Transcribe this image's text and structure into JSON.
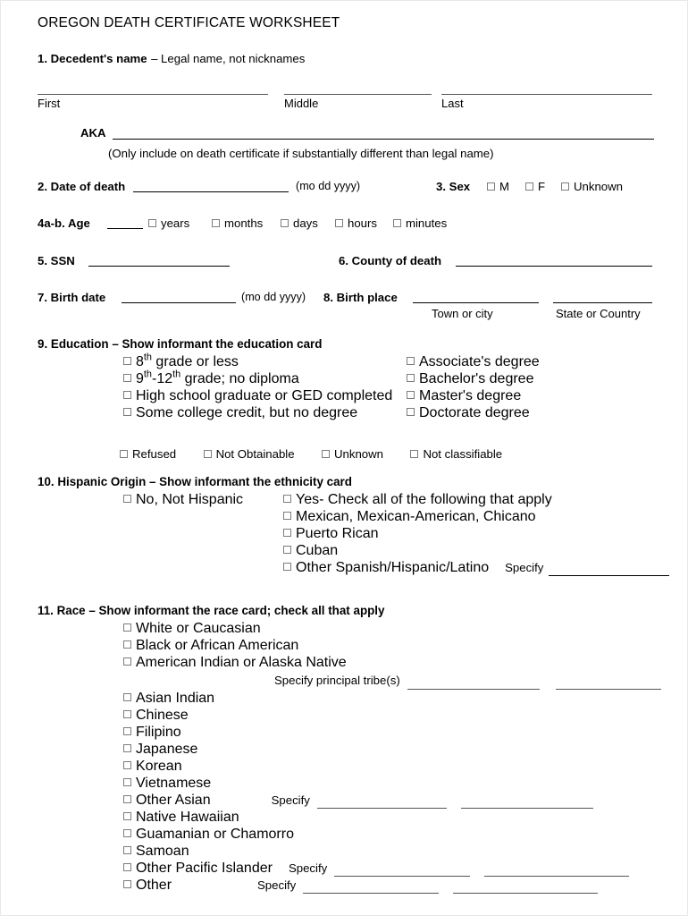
{
  "document": {
    "title": "OREGON DEATH CERTIFICATE WORKSHEET"
  },
  "q1": {
    "number_label": "1. Decedent's name",
    "dash_note": "– Legal name, not nicknames",
    "first_label": "First",
    "middle_label": "Middle",
    "last_label": "Last",
    "aka_label": "AKA",
    "aka_note": "(Only include on death certificate if substantially different than legal name)"
  },
  "q2": {
    "label": "2. Date of death",
    "format_hint": "(mo dd yyyy)"
  },
  "q3": {
    "label": "3. Sex",
    "options": [
      "M",
      "F",
      "Unknown"
    ]
  },
  "q4": {
    "label": "4a-b. Age",
    "units": [
      "years",
      "months",
      "days",
      "hours",
      "minutes"
    ]
  },
  "q5": {
    "label": "5. SSN"
  },
  "q6": {
    "label": "6. County of death"
  },
  "q7": {
    "label": "7. Birth date",
    "format_hint": "(mo dd yyyy)"
  },
  "q8": {
    "label": "8. Birth place",
    "town_label": "Town or city",
    "state_label": "State or Country"
  },
  "q9": {
    "heading": "9. Education – Show informant the education card",
    "left_options": [
      "8th grade or less",
      "9th-12th grade; no diploma",
      "High school graduate or GED completed",
      "Some college credit, but no degree"
    ],
    "right_options": [
      "Associate's degree",
      "Bachelor's degree",
      "Master's degree",
      "Doctorate degree"
    ],
    "extra_options": [
      "Refused",
      "Not Obtainable",
      "Unknown",
      "Not classifiable"
    ]
  },
  "q10": {
    "heading": "10. Hispanic Origin – Show informant the ethnicity card",
    "left_options": [
      "No, Not Hispanic"
    ],
    "right_options": [
      "Yes- Check all of the following that apply",
      "Mexican, Mexican-American, Chicano",
      "Puerto Rican",
      "Cuban",
      "Other Spanish/Hispanic/Latino"
    ],
    "specify_label": "Specify"
  },
  "q11": {
    "heading": "11. Race – Show informant the race card; check all that apply",
    "options": [
      "White or Caucasian",
      "Black or African American",
      "American Indian or Alaska Native",
      "Asian Indian",
      "Chinese",
      "Filipino",
      "Japanese",
      "Korean",
      "Vietnamese",
      "Other Asian",
      "Native Hawaiian",
      "Guamanian or Chamorro",
      "Samoan",
      "Other Pacific Islander",
      "Other"
    ],
    "tribe_label": "Specify principal tribe(s)",
    "specify_label": "Specify"
  },
  "colors": {
    "text": "#000000",
    "rule": "#555555",
    "checkbox_border": "#7d7d7d"
  }
}
